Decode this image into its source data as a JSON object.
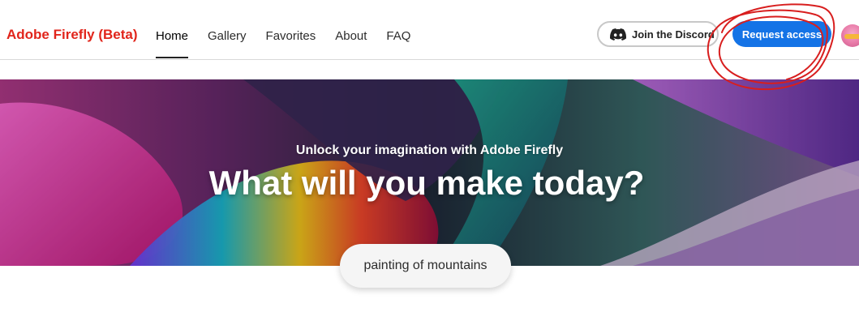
{
  "header": {
    "brand": "Adobe Firefly (Beta)",
    "nav": [
      {
        "label": "Home",
        "active": true
      },
      {
        "label": "Gallery",
        "active": false
      },
      {
        "label": "Favorites",
        "active": false
      },
      {
        "label": "About",
        "active": false
      },
      {
        "label": "FAQ",
        "active": false
      }
    ],
    "discord_button": {
      "label": "Join the Discord",
      "icon": "discord-icon"
    },
    "request_button": {
      "label": "Request access"
    },
    "avatar": {
      "icon": "user-avatar"
    }
  },
  "hero": {
    "subtitle": "Unlock your imagination with Adobe Firefly",
    "title": "What will you make today?",
    "prompt_pill": "painting of mountains"
  },
  "annotation": {
    "color": "#d81e1e",
    "shape": "red-scribble-circle"
  },
  "colors": {
    "brand_red": "#e1251b",
    "primary_blue": "#1473e6"
  }
}
